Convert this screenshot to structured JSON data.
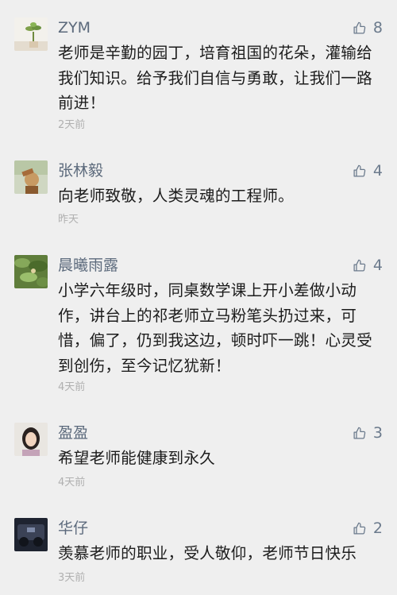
{
  "comments": [
    {
      "name": "ZYM",
      "likes": "8",
      "text": "老师是辛勤的园丁，培育祖国的花朵，灌输给我们知识。给予我们自信与勇敢，让我们一路前进！",
      "time": "2天前"
    },
    {
      "name": "张林毅",
      "likes": "4",
      "text": "向老师致敬，人类灵魂的工程师。",
      "time": "昨天"
    },
    {
      "name": "晨曦雨露",
      "likes": "4",
      "text": "小学六年级时，同桌数学课上开小差做小动作，讲台上的祁老师立马粉笔头扔过来，可惜，偏了，仍到我这边，顿时吓一跳！心灵受到创伤，至今记忆犹新！",
      "time": "4天前"
    },
    {
      "name": "盈盈",
      "likes": "3",
      "text": "希望老师能健康到永久",
      "time": "4天前"
    },
    {
      "name": "华仔",
      "likes": "2",
      "text": "羡慕老师的职业，受人敬仰，老师节日快乐",
      "time": "3天前"
    }
  ]
}
